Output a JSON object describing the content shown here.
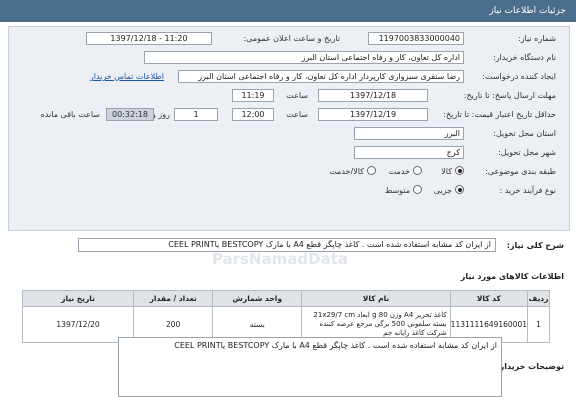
{
  "header": {
    "title": "جزئیات اطلاعات نیاز"
  },
  "fields": {
    "need_number_label": "شماره نیاز:",
    "need_number": "1197003833000040",
    "announce_label": "تاریخ و ساعت اعلان عمومی:",
    "announce_value": "1397/12/18 - 11:20",
    "buyer_org_label": "نام دستگاه خریدار:",
    "buyer_org": "اداره کل تعاون، کار و رفاه اجتماعی استان البرز",
    "creator_label": "ایجاد کننده درخواست:",
    "creator": "رضا سنقری سبزواری کارپرداز اداره کل تعاون، کار و رفاه اجتماعی استان البرز",
    "contact_link": "اطلاعات تماس خریدار",
    "send_deadline_label": "مهلت ارسال پاسخ: تا تاریخ:",
    "send_deadline_date": "1397/12/18",
    "time_label": "ساعت",
    "send_deadline_time": "11:19",
    "validity_label": "حداقل تاریخ اعتبار قیمت: تا تاریخ:",
    "validity_date": "1397/12/19",
    "validity_time": "12:00",
    "days_value": "1",
    "days_label": "روز و",
    "remaining_time": "00:32:18",
    "remaining_label": "ساعت باقی مانده",
    "province_label": "استان محل تحویل:",
    "province": "البرز",
    "city_label": "شهر محل تحویل:",
    "city": "کرج",
    "category_label": "طبقه بندی موضوعی:",
    "category_options": [
      "کالا",
      "خدمت",
      "کالا/خدمت"
    ],
    "purchase_type_label": "نوع فرآیند خرید :",
    "purchase_type_options": [
      "جزیی",
      "متوسط"
    ]
  },
  "general_desc": {
    "label": "شرح کلی نیاز:",
    "text": "از ایران کد مشابه استفاده شده است . کاغذ چاپگر قطع A4 با مارک  BESTCOPY  یاCEEL PRINT"
  },
  "goods": {
    "section_title": "اطلاعات کالاهای مورد نیاز",
    "columns": [
      "ردیف",
      "کد کالا",
      "نام کالا",
      "واحد شمارش",
      "تعداد / مقدار",
      "تاریخ نیاز"
    ],
    "rows": [
      {
        "row": "1",
        "code": "1131111649160001",
        "name": "کاغذ تحریر A4 وزن 80 g ابعاد 21x29/7 cm بسته سلفونی 500 برگی مرجع عرضه کننده شرکت کاغذ رایانه جم",
        "unit": "بسته",
        "qty": "200",
        "date": "1397/12/20"
      }
    ]
  },
  "buyer_desc": {
    "label": "توضیحات خریدار:",
    "text": "از ایران کد مشابه استفاده شده است . کاغذ چاپگر قطع A4 با مارک  BESTCOPY  یاCEEL PRINT"
  },
  "watermark": "ParsNamadData"
}
